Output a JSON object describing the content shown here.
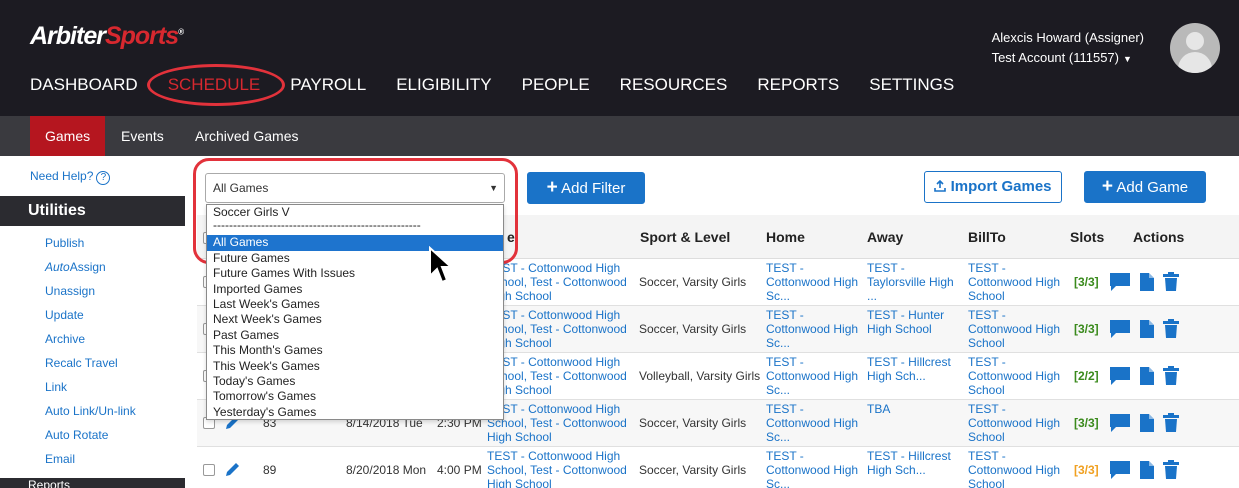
{
  "brand": {
    "name_a": "Arbiter",
    "name_b": "Sports",
    "mark": "®"
  },
  "user": {
    "name": "Alexcis Howard (Assigner)",
    "account": "Test Account (111557)"
  },
  "main_nav": [
    {
      "label": "DASHBOARD"
    },
    {
      "label": "SCHEDULE",
      "active": true
    },
    {
      "label": "PAYROLL"
    },
    {
      "label": "ELIGIBILITY"
    },
    {
      "label": "PEOPLE"
    },
    {
      "label": "RESOURCES"
    },
    {
      "label": "REPORTS"
    },
    {
      "label": "SETTINGS"
    }
  ],
  "sub_nav": [
    {
      "label": "Games",
      "active": true
    },
    {
      "label": "Events"
    },
    {
      "label": "Archived Games"
    }
  ],
  "sidebar": {
    "help": "Need Help?",
    "help_icon": "?",
    "utilities_title": "Utilities",
    "items": [
      "Publish",
      "AutoAssign",
      "Unassign",
      "Update",
      "Archive",
      "Recalc Travel",
      "Link",
      "Auto Link/Un-link",
      "Auto Rotate",
      "Email"
    ],
    "autoassign_prefix": "Auto",
    "autoassign_suffix": "Assign",
    "next_section": "Reports"
  },
  "toolbar": {
    "filter_value": "All Games",
    "add_filter": "Add Filter",
    "import_games": "Import Games",
    "add_game": "Add Game"
  },
  "dropdown": {
    "options": [
      {
        "label": "Soccer Girls V"
      },
      {
        "label": "----------------------------------------------------",
        "separator": true
      },
      {
        "label": "All Games",
        "selected": true
      },
      {
        "label": "Future Games"
      },
      {
        "label": "Future Games With Issues"
      },
      {
        "label": "Imported Games"
      },
      {
        "label": "Last Week's Games"
      },
      {
        "label": "Next Week's Games"
      },
      {
        "label": "Past Games"
      },
      {
        "label": "This Month's Games"
      },
      {
        "label": "This Week's Games"
      },
      {
        "label": "Today's Games"
      },
      {
        "label": "Tomorrow's Games"
      },
      {
        "label": "Yesterday's Games"
      }
    ]
  },
  "table": {
    "headers": {
      "site": "e",
      "sport": "Sport & Level",
      "home": "Home",
      "away": "Away",
      "billto": "BillTo",
      "slots": "Slots",
      "actions": "Actions"
    },
    "rows": [
      {
        "id": "",
        "date": "",
        "time": "",
        "site_1": "TEST - Cottonwood High",
        "site_2": "School, Test - Cottonwood",
        "site_3": "High School",
        "sport": "Soccer, Varsity Girls",
        "home_1": "TEST -",
        "home_2": "Cottonwood High",
        "home_3": "Sc...",
        "away_1": "TEST -",
        "away_2": "Taylorsville High",
        "away_3": "...",
        "bill_1": "TEST -",
        "bill_2": "Cottonwood High",
        "bill_3": "School",
        "slots": "[3/3]",
        "slots_color": "#3a8a1c"
      },
      {
        "id": "",
        "date": "",
        "time": "",
        "site_1": "TEST - Cottonwood High",
        "site_2": "School, Test - Cottonwood",
        "site_3": "High School",
        "sport": "Soccer, Varsity Girls",
        "home_1": "TEST -",
        "home_2": "Cottonwood High",
        "home_3": "Sc...",
        "away_1": "TEST - Hunter",
        "away_2": "High School",
        "away_3": "",
        "bill_1": "TEST -",
        "bill_2": "Cottonwood High",
        "bill_3": "School",
        "slots": "[3/3]",
        "slots_color": "#3a8a1c"
      },
      {
        "id": "",
        "date": "",
        "time": "",
        "site_1": "TEST - Cottonwood High",
        "site_2": "School, Test - Cottonwood",
        "site_3": "High School",
        "sport": "Volleyball, Varsity Girls",
        "home_1": "TEST -",
        "home_2": "Cottonwood High",
        "home_3": "Sc...",
        "away_1": "TEST - Hillcrest",
        "away_2": "High Sch...",
        "away_3": "",
        "bill_1": "TEST -",
        "bill_2": "Cottonwood High",
        "bill_3": "School",
        "slots": "[2/2]",
        "slots_color": "#3a8a1c"
      },
      {
        "id": "83",
        "date": "8/14/2018 Tue",
        "time": "2:30 PM",
        "site_1": "TEST - Cottonwood High",
        "site_2": "School, Test - Cottonwood",
        "site_3": "High School",
        "sport": "Soccer, Varsity Girls",
        "home_1": "TEST -",
        "home_2": "Cottonwood High",
        "home_3": "Sc...",
        "away_1": "TBA",
        "away_2": "",
        "away_3": "",
        "bill_1": "TEST -",
        "bill_2": "Cottonwood High",
        "bill_3": "School",
        "slots": "[3/3]",
        "slots_color": "#3a8a1c"
      },
      {
        "id": "89",
        "date": "8/20/2018 Mon",
        "time": "4:00 PM",
        "site_1": "TEST - Cottonwood High",
        "site_2": "School, Test - Cottonwood",
        "site_3": "High School",
        "sport": "Soccer, Varsity Girls",
        "home_1": "TEST -",
        "home_2": "Cottonwood High",
        "home_3": "Sc...",
        "away_1": "TEST - Hillcrest",
        "away_2": "High Sch...",
        "away_3": "",
        "bill_1": "TEST -",
        "bill_2": "Cottonwood High",
        "bill_3": "School",
        "slots": "[3/3]",
        "slots_color": "#f0a020"
      }
    ]
  },
  "icons": {
    "pencil": "pencil-icon",
    "chat": "chat-icon",
    "document": "document-icon",
    "trash": "trash-icon",
    "plus": "plus-icon",
    "upload": "upload-icon",
    "cursor": "mouse-cursor-icon"
  },
  "colors": {
    "brand_red": "#d7282f",
    "link_blue": "#1a73c8",
    "header_bg": "#1c1b22",
    "annotation_red": "#e2323b"
  }
}
